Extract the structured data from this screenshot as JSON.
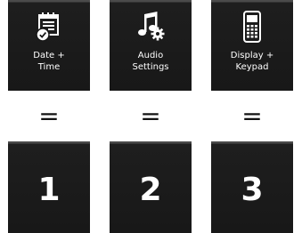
{
  "menu": {
    "items": [
      {
        "icon": "calendar-clock-icon",
        "label": "Date +\nTime"
      },
      {
        "icon": "music-gear-icon",
        "label": "Audio\nSettings"
      },
      {
        "icon": "phone-keypad-icon",
        "label": "Display +\nKeypad"
      }
    ]
  },
  "mapping": {
    "equals": [
      "=",
      "=",
      "="
    ]
  },
  "keys": {
    "items": [
      {
        "digit": "1"
      },
      {
        "digit": "2"
      },
      {
        "digit": "3"
      }
    ]
  },
  "colors": {
    "tile_background": "#181818",
    "tile_text": "#ffffff",
    "page_background": "#ffffff"
  }
}
